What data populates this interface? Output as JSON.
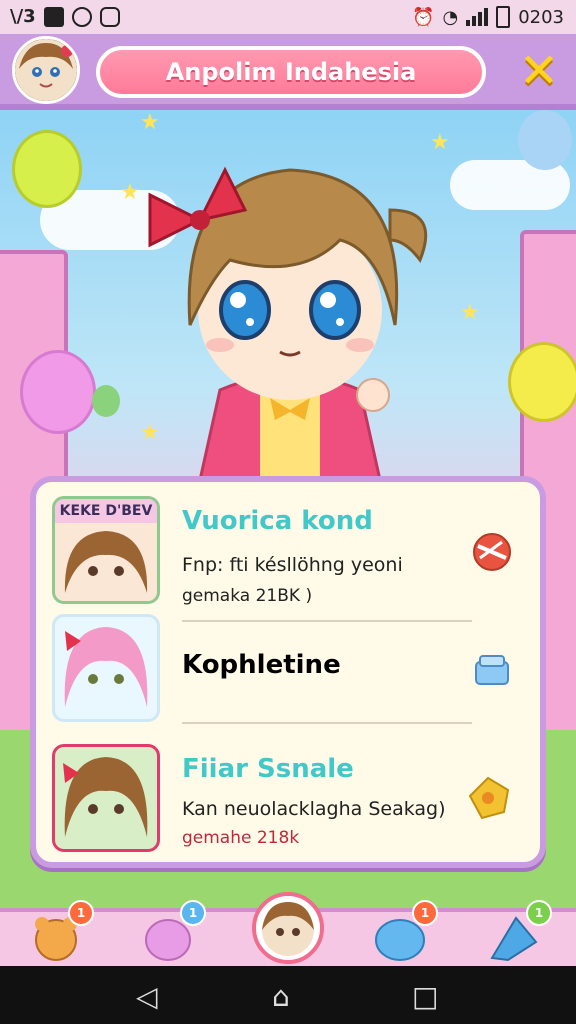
{
  "status_bar": {
    "left_text": "\\/3",
    "time": "0203"
  },
  "header": {
    "title": "Anpolim Indahesia",
    "close_label": "✕"
  },
  "list": [
    {
      "title": "Vuorica kond",
      "subtitle": "Fnp: fti késllöhng yeoni",
      "meta": "gemaka 21BK )",
      "title_color": "#41c8c9",
      "title_color2": "#f0c419",
      "thumb_label": "KEKE D'BEV",
      "icon": "candy-icon"
    },
    {
      "title": "Kophletine",
      "subtitle": "",
      "meta": "",
      "title_color": "#e8436a",
      "icon": "gift-box-icon"
    },
    {
      "title": "Fiiar Ssnale",
      "subtitle": "Kan neuolacklagha Seakag)",
      "meta": "gemahe 218k",
      "title_color": "#41c8c9",
      "title_color2": "#f0c419",
      "icon": "gold-badge-icon"
    }
  ],
  "bottom_nav": [
    {
      "name": "bear",
      "badge": "1"
    },
    {
      "name": "cat",
      "badge": "1"
    },
    {
      "name": "home-avatar",
      "badge": ""
    },
    {
      "name": "blob",
      "badge": "1"
    },
    {
      "name": "flag",
      "badge": "1"
    }
  ],
  "colors": {
    "header_bg": "#c99be0",
    "accent_pink": "#ff7a98",
    "close_yellow": "#ffd31f",
    "card_border": "#c99be0"
  }
}
